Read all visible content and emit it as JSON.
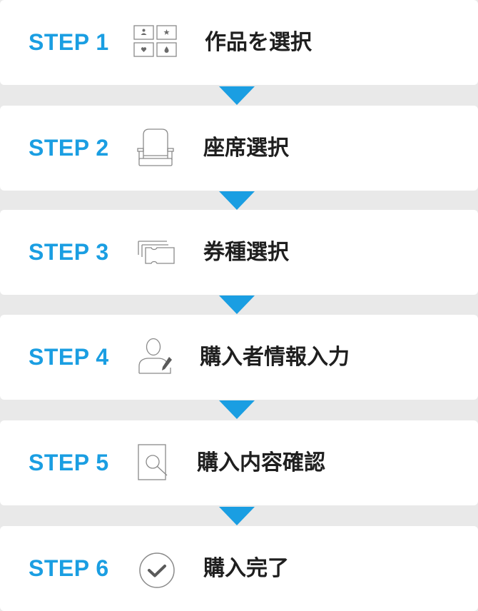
{
  "accent_color": "#1a9ee2",
  "steps": [
    {
      "label": "STEP 1",
      "title": "作品を選択",
      "icon": "movie-grid-icon"
    },
    {
      "label": "STEP 2",
      "title": "座席選択",
      "icon": "seat-icon"
    },
    {
      "label": "STEP 3",
      "title": "券種選択",
      "icon": "ticket-icon"
    },
    {
      "label": "STEP 4",
      "title": "購入者情報入力",
      "icon": "user-edit-icon"
    },
    {
      "label": "STEP 5",
      "title": "購入内容確認",
      "icon": "document-search-icon"
    },
    {
      "label": "STEP 6",
      "title": "購入完了",
      "icon": "check-circle-icon"
    }
  ]
}
